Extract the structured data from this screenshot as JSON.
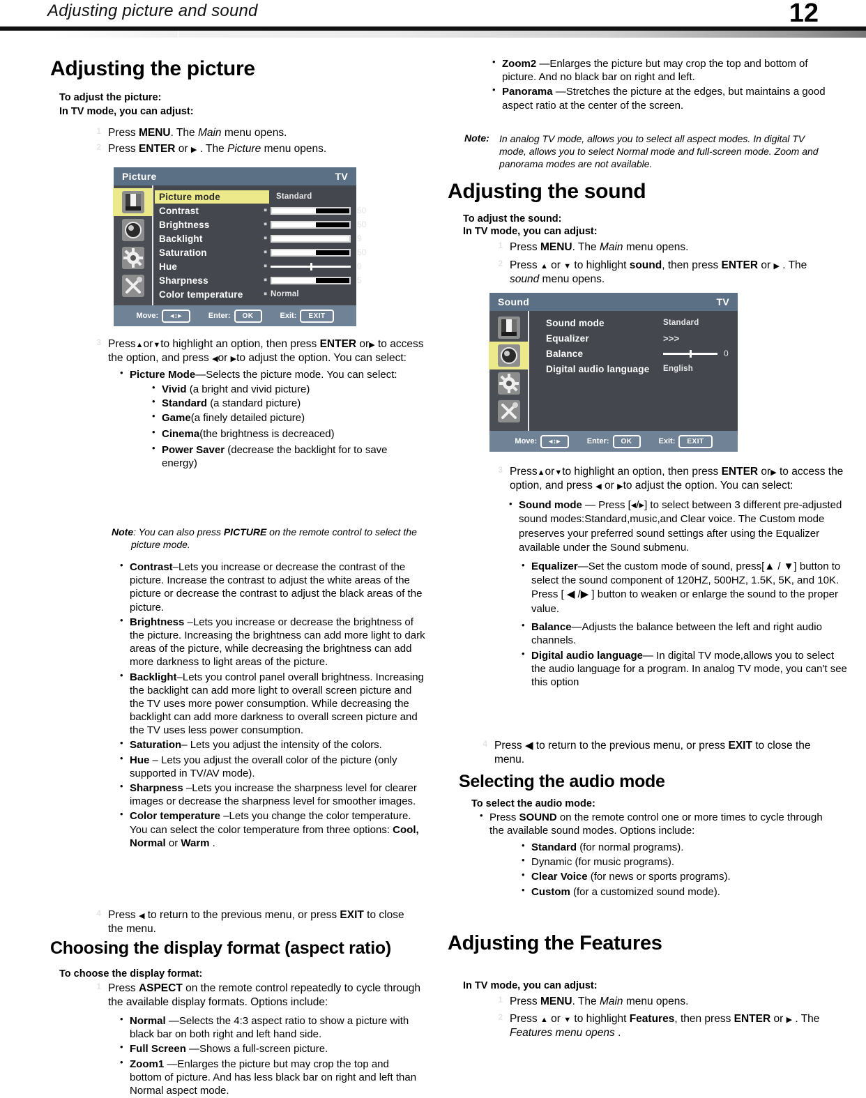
{
  "header": {
    "title": "Adjusting picture and sound",
    "page_number": "12"
  },
  "left_column": {
    "heading": "Adjusting the picture",
    "intro_line1": "To adjust the picture:",
    "intro_line2": "In TV mode, you can adjust:",
    "step1_num": "1",
    "step1_text": "Press MENU. The Main menu opens.",
    "step2_num": "2",
    "step2_text": "Press ENTER or ▶ . The Picture  menu opens.",
    "picture_menu": {
      "title": "Picture",
      "source": "TV",
      "rows": [
        {
          "label": "Picture mode",
          "type": "text",
          "value": "Standard",
          "selected": true
        },
        {
          "label": "Contrast",
          "type": "bar",
          "value": "50",
          "fill_pct": 57
        },
        {
          "label": "Brightness",
          "type": "bar",
          "value": "50",
          "fill_pct": 57
        },
        {
          "label": "Backlight",
          "type": "bar",
          "value": "9",
          "fill_pct": 100
        },
        {
          "label": "Saturation",
          "type": "bar",
          "value": "50",
          "fill_pct": 57
        },
        {
          "label": "Hue",
          "type": "center",
          "value": "0",
          "fill_pct": 50
        },
        {
          "label": "Sharpness",
          "type": "bar",
          "value": "5",
          "fill_pct": 57
        },
        {
          "label": "Color temperature",
          "type": "text",
          "value": "Normal"
        }
      ],
      "footer": {
        "move_label": "Move:",
        "move_key": "◂↕▸",
        "enter_label": "Enter:",
        "enter_key": "OK",
        "exit_label": "Exit:",
        "exit_key": "EXIT"
      },
      "icons": [
        "picture-icon",
        "sound-icon",
        "settings-gear-icon",
        "tools-icon"
      ]
    },
    "step3_num": "3",
    "step3_text": "Press ▲or▼ to highlight an option, then press ENTER or▶ to access the option, and press ◀ or ▶to adjust  the option. You can select:",
    "picture_mode_bullet": "Picture Mode—Selects the picture mode. You can select:",
    "picture_modes": [
      {
        "name": "Vivid",
        "desc": "(a bright and vivid picture)"
      },
      {
        "name": "Standard",
        "desc": "(a standard picture)"
      },
      {
        "name": "Game",
        "desc": "(a finely detailed picture)"
      },
      {
        "name": "Cinema",
        "desc": "(the brightness is decreaced)"
      },
      {
        "name": "Power Saver",
        "desc": "(decrease the backlight for to save energy)"
      }
    ],
    "note_label": "Note",
    "note_text": ": You can also press PICTURE on the remote control to select the picture mode.",
    "options": [
      {
        "name": "Contrast",
        "desc": "–Lets you increase or decrease the contrast of the picture. Increase the contrast to adjust the white areas of the picture or decrease the contrast to adjust the black areas of the picture."
      },
      {
        "name": "Brightness",
        "desc": " –Lets you increase or decrease the brightness of the picture. Increasing the brightness can add more light to dark areas of the picture, while decreasing the brightness can add more darkness to light areas of the picture."
      },
      {
        "name": "Backlight",
        "desc": "–Lets you control panel overall brightness. Increasing the backlight can add more light to overall screen picture and the TV uses more power consumption. While decreasing the backlight can add more darkness to overall screen picture and the TV uses less power consumption."
      },
      {
        "name": "Saturation",
        "desc": "– Lets you adjust the intensity of the colors."
      },
      {
        "name": "Hue",
        "desc": " – Lets you adjust the overall color of the picture (only supported in TV/AV mode)."
      },
      {
        "name": "Sharpness",
        "desc": " –Lets you increase the sharpness level for clearer images or decrease the sharpness level for smoother images."
      },
      {
        "name": "Color temperature",
        "desc": " –Lets you change the color temperature. You can select the color temperature from three options: Cool,  Normal  or Warm ."
      }
    ],
    "step4_num": "4",
    "step4_text": "Press ◀ to return to the previous menu, or press  EXIT to close the menu.",
    "aspect_heading": "Choosing the display format (aspect ratio)",
    "aspect_sub": "To choose the display format:",
    "aspect_step1_num": "1",
    "aspect_step1_text": "Press ASPECT on the remote control repeatedly to cycle through the available display formats. Options include:",
    "aspect_options": [
      {
        "name": "Normal ",
        "desc": "—Selects the 4:3 aspect ratio to show a picture with black bar on both right and left hand side."
      },
      {
        "name": "Full Screen ",
        "desc": "—Shows a full-screen picture."
      },
      {
        "name": "Zoom1 ",
        "desc": "—Enlarges the picture but may crop the top and bottom of picture. And has less black bar on right and left than Normal aspect mode."
      }
    ]
  },
  "right_column": {
    "aspect_options_cont": [
      {
        "name": "Zoom2 ",
        "desc": "—Enlarges the picture but may crop the top and bottom of picture. And no black bar on right and left."
      },
      {
        "name": "Panorama  ",
        "desc": "—Stretches the picture at the edges, but maintains a good aspect ratio at the center  of the screen."
      }
    ],
    "note_label": "Note:",
    "note_text": "In analog TV mode, allows you to select all aspect modes. In digital TV mode, allows you to select Normal mode and full-screen mode. Zoom and panorama modes are not available.",
    "sound_heading": "Adjusting the sound",
    "sound_sub1": "To adjust the sound:",
    "sound_sub2": "In TV mode, you can adjust:",
    "sound_step1_num": "1",
    "sound_step1_text": "Press MENU. The Main menu opens.",
    "sound_step2_num": "2",
    "sound_step2_text": "Press ▲ or ▼ to highlight sound, then press ENTER or ▶ . The sound menu opens.",
    "sound_menu": {
      "title": "Sound",
      "source": "TV",
      "rows": [
        {
          "label": "Sound mode",
          "type": "text",
          "value": "Standard"
        },
        {
          "label": "Equalizer",
          "type": "text",
          "value": ">>>"
        },
        {
          "label": "Balance",
          "type": "center",
          "value": "0",
          "fill_pct": 50
        },
        {
          "label": "Digital audio language",
          "type": "text",
          "value": "English"
        }
      ],
      "footer": {
        "move_label": "Move:",
        "move_key": "◂↕▸",
        "enter_label": "Enter:",
        "enter_key": "OK",
        "exit_label": "Exit:",
        "exit_key": "EXIT"
      },
      "icons": [
        "picture-icon",
        "sound-icon",
        "settings-gear-icon",
        "tools-icon"
      ],
      "selected_icon_index": 1
    },
    "sound_step3_num": "3",
    "sound_step3_text": "Press ▲or▼to highlight an option, then press ENTER or▶ to access the option, and press ◀ or ▶to adjust  the option. You can select:",
    "sound_options": [
      {
        "name": "Sound mode ",
        "desc": "— Press [◂/▸] to select between 3 different pre-adjusted sound modes:Standard,music,and Clear voice. The Custom mode preserves your preferred sound settings after using the Equalizer available under the Sound submenu."
      },
      {
        "name": "Equalizer",
        "desc": "—Set the custom mode of sound, press[▲ / ▼] button to select the sound component of 120HZ, 500HZ, 1.5K, 5K, and 10K. Press [ ◀ /▶  ]  button to weaken or enlarge the sound to the proper value."
      },
      {
        "name": "Balance",
        "desc": "—Adjusts the balance between the left and right audio channels."
      },
      {
        "name": "Digital audio language",
        "desc": "—  In digital TV mode,allows you to select the audio language for a program. In analog TV mode, you can't see this option"
      }
    ],
    "sound_step4_num": "4",
    "sound_step4_text": "Press  ◀   to return to the previous menu, or press  EXIT  to close the menu.",
    "audio_mode_heading": "Selecting the audio mode",
    "audio_mode_sub": "To select the audio mode:",
    "audio_mode_bullet": "Press SOUND on the remote control one or more times to cycle through the available sound modes. Options include:",
    "audio_modes": [
      {
        "name": "Standard ",
        "desc": "(for normal programs)."
      },
      {
        "name": " Dynamic  ",
        "desc": "(for music programs).",
        "plain": true
      },
      {
        "name": "Clear Voice ",
        "desc": "(for news or sports programs)."
      },
      {
        "name": "Custom  ",
        "desc": "(for a customized sound mode)."
      }
    ],
    "features_heading": "Adjusting the Features",
    "features_sub": "In TV mode, you can adjust:",
    "features_step1_num": "1",
    "features_step1_text": "Press MENU. The Main menu opens.",
    "features_step2_num": "2",
    "features_step2_text": "Press ▲ or ▼ to highlight Features, then press ENTER or ▶ . The Features menu opens ."
  }
}
